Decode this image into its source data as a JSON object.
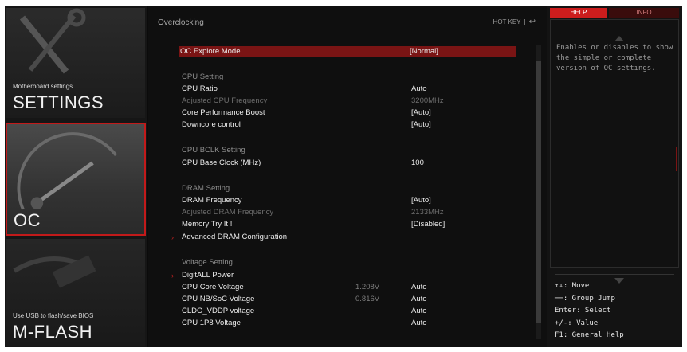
{
  "left_panel": {
    "settings": {
      "subtitle": "Motherboard settings",
      "title": "SETTINGS"
    },
    "oc": {
      "title": "OC"
    },
    "mflash": {
      "subtitle": "Use USB to flash/save BIOS",
      "title": "M-FLASH"
    }
  },
  "header": {
    "breadcrumb": "Overclocking",
    "hotkey_label": "HOT KEY",
    "hotkey_sep": "|",
    "back_glyph": "↩"
  },
  "rows": [
    {
      "label": "OC Explore Mode",
      "value": "[Normal]",
      "type": "item",
      "selected": true
    },
    {
      "label": "CPU  Setting",
      "type": "section"
    },
    {
      "label": "CPU Ratio",
      "value": "Auto",
      "type": "item"
    },
    {
      "label": "Adjusted CPU Frequency",
      "value": "3200MHz",
      "type": "dim"
    },
    {
      "label": "Core Performance Boost",
      "value": "[Auto]",
      "type": "item"
    },
    {
      "label": "Downcore control",
      "value": "[Auto]",
      "type": "item"
    },
    {
      "label": "CPU  BCLK  Setting",
      "type": "section"
    },
    {
      "label": "CPU Base Clock (MHz)",
      "value": "100",
      "type": "item"
    },
    {
      "label": "DRAM  Setting",
      "type": "section"
    },
    {
      "label": "DRAM Frequency",
      "value": "[Auto]",
      "type": "item"
    },
    {
      "label": "Adjusted DRAM Frequency",
      "value": "2133MHz",
      "type": "dim"
    },
    {
      "label": "Memory Try It !",
      "value": "[Disabled]",
      "type": "item"
    },
    {
      "label": "Advanced DRAM Configuration",
      "type": "submenu"
    },
    {
      "label": "Voltage  Setting",
      "type": "section"
    },
    {
      "label": "DigitALL Power",
      "type": "submenu"
    },
    {
      "label": "CPU Core Voltage",
      "current": "1.208V",
      "value": "Auto",
      "type": "item"
    },
    {
      "label": "CPU NB/SoC Voltage",
      "current": "0.816V",
      "value": "Auto",
      "type": "item"
    },
    {
      "label": "CLDO_VDDP voltage",
      "value": "Auto",
      "type": "item"
    },
    {
      "label": "CPU 1P8 Voltage",
      "value": "Auto",
      "type": "item"
    }
  ],
  "right_panel": {
    "tab_help": "HELP",
    "tab_info": "INFO",
    "help_text": "Enables or disables to show the simple or complete version of OC settings.",
    "keys": [
      {
        "text": "↑↓: Move"
      },
      {
        "text": "──: Group Jump"
      },
      {
        "text": "Enter: Select"
      },
      {
        "text": "+/-: Value"
      },
      {
        "text": "F1: General Help"
      }
    ]
  },
  "colors": {
    "accent": "#c21a1a",
    "selected_row": "#7a1414",
    "background": "#0f0f0f"
  }
}
